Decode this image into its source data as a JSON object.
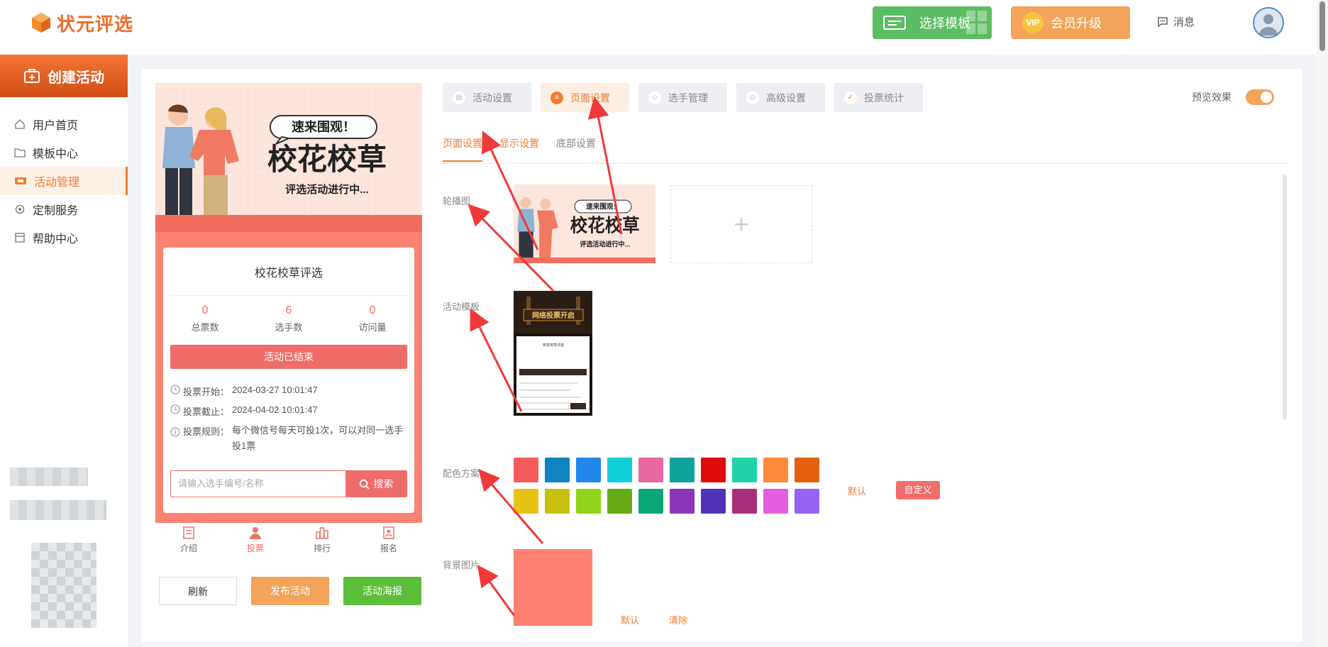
{
  "brand": {
    "name": "状元评选"
  },
  "header": {
    "template_btn": "选择模板",
    "vip_btn": "会员升级",
    "vip_badge": "VIP",
    "messages": "消息"
  },
  "sidebar": {
    "create": "创建活动",
    "items": [
      {
        "label": "用户首页",
        "icon": "home-icon"
      },
      {
        "label": "模板中心",
        "icon": "folder-icon"
      },
      {
        "label": "活动管理",
        "icon": "ticket-icon",
        "active": true
      },
      {
        "label": "定制服务",
        "icon": "settings-icon"
      },
      {
        "label": "帮助中心",
        "icon": "help-box-icon"
      }
    ]
  },
  "phone": {
    "banner": {
      "bubble": "速来围观！",
      "title": "校花校草",
      "subtitle": "评选活动进行中..."
    },
    "activity_title": "校花校草评选",
    "stats": [
      {
        "value": "0",
        "label": "总票数"
      },
      {
        "value": "6",
        "label": "选手数"
      },
      {
        "value": "0",
        "label": "访问量"
      }
    ],
    "status": "活动已结束",
    "info": [
      {
        "label": "投票开始：",
        "value": "2024-03-27 10:01:47"
      },
      {
        "label": "投票截止：",
        "value": "2024-04-02 10:01:47"
      },
      {
        "label": "投票规则：",
        "value": "每个微信号每天可投1次，可以对同一选手投1票"
      }
    ],
    "search_placeholder": "请输入选手编号/名称",
    "search_btn": "搜索",
    "tabs": [
      "介绍",
      "投票",
      "排行",
      "报名"
    ]
  },
  "actions": {
    "refresh": "刷新",
    "publish": "发布活动",
    "poster": "活动海报"
  },
  "settings": {
    "tabs": [
      "活动设置",
      "页面设置",
      "选手管理",
      "高级设置",
      "投票统计"
    ],
    "active_tab": 1,
    "preview_label": "预览效果",
    "preview_on": true,
    "subtabs": [
      "页面设置",
      "显示设置",
      "底部设置"
    ],
    "labels": {
      "carousel": "轮播图",
      "template": "活动模板",
      "color": "配色方案",
      "background": "背景图片"
    },
    "template_banner": "网络投票开启",
    "template_card_title": "校花校草评选",
    "colors": [
      "#f65b5b",
      "#0f84c0",
      "#2187ec",
      "#10cfd6",
      "#e869a0",
      "#0fa29b",
      "#e00b0b",
      "#1fd3a6",
      "#ff8a3b",
      "#e5600e",
      "#e8c215",
      "#c6c00f",
      "#8fd31a",
      "#64aa14",
      "#0aa877",
      "#8b35b8",
      "#5132b8",
      "#a8307a",
      "#e35fe0",
      "#9463f1"
    ],
    "color_default": "默认",
    "color_custom": "自定义",
    "bg_default": "默认",
    "bg_clear": "清除"
  }
}
